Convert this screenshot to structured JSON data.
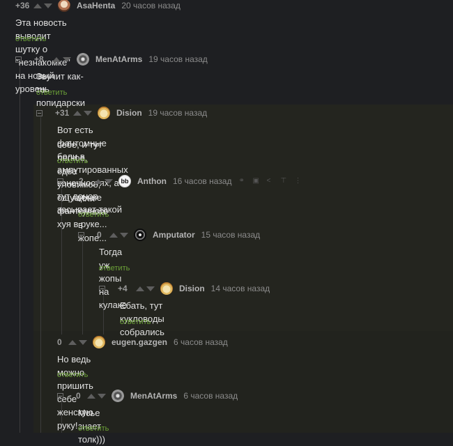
{
  "comments": [
    {
      "rating": "+36",
      "author": "AsaHenta",
      "time": "20 часов назад",
      "text": "Эта новость выводит шутку о \"незнакомке\" на новый уровень",
      "reply": "ответить"
    },
    {
      "rating": "+8",
      "author": "MenAtArms",
      "time": "19 часов назад",
      "text": "Звучит как-то попидарски",
      "reply": "ответить"
    },
    {
      "rating": "+31",
      "author": "Dision",
      "time": "19 часов назад",
      "text1": "Вот есть фантомные боли в ампутированных конечностях, а тут донор засыпает такой",
      "text2": "себе, и тут лёгкое, едва уловимое, ощущение фантомного хуя в руке...",
      "reply": "ответить"
    },
    {
      "rating": "-2",
      "author": "Anthon",
      "time": "16 часов назад",
      "text": "Или кулака в жопе...",
      "reply": "ответить"
    },
    {
      "rating": "0",
      "author": "Amputator",
      "time": "15 часов назад",
      "text": "Тогда уж жопы на кулаке",
      "reply": "ответить"
    },
    {
      "rating": "+4",
      "author": "Dision",
      "time": "14 часов назад",
      "text": "Ебать, тут кукловоды собрались",
      "reply": "ответить"
    },
    {
      "rating": "0",
      "author": "eugen.gazgen",
      "time": "6 часов назад",
      "text": "Но ведь можно пришить себе женскую руку!",
      "reply": "ответить"
    },
    {
      "rating": "0",
      "author": "MenAtArms",
      "time": "6 часов назад",
      "text": "Мсье знает толк)))",
      "reply": "ответить"
    }
  ],
  "colors": {
    "reply": "#6da338",
    "background": "#1e1f22",
    "nested_background": "#24251f"
  },
  "icons": [
    "link-icon",
    "save-icon",
    "share-icon",
    "pin-icon",
    "more-icon"
  ]
}
